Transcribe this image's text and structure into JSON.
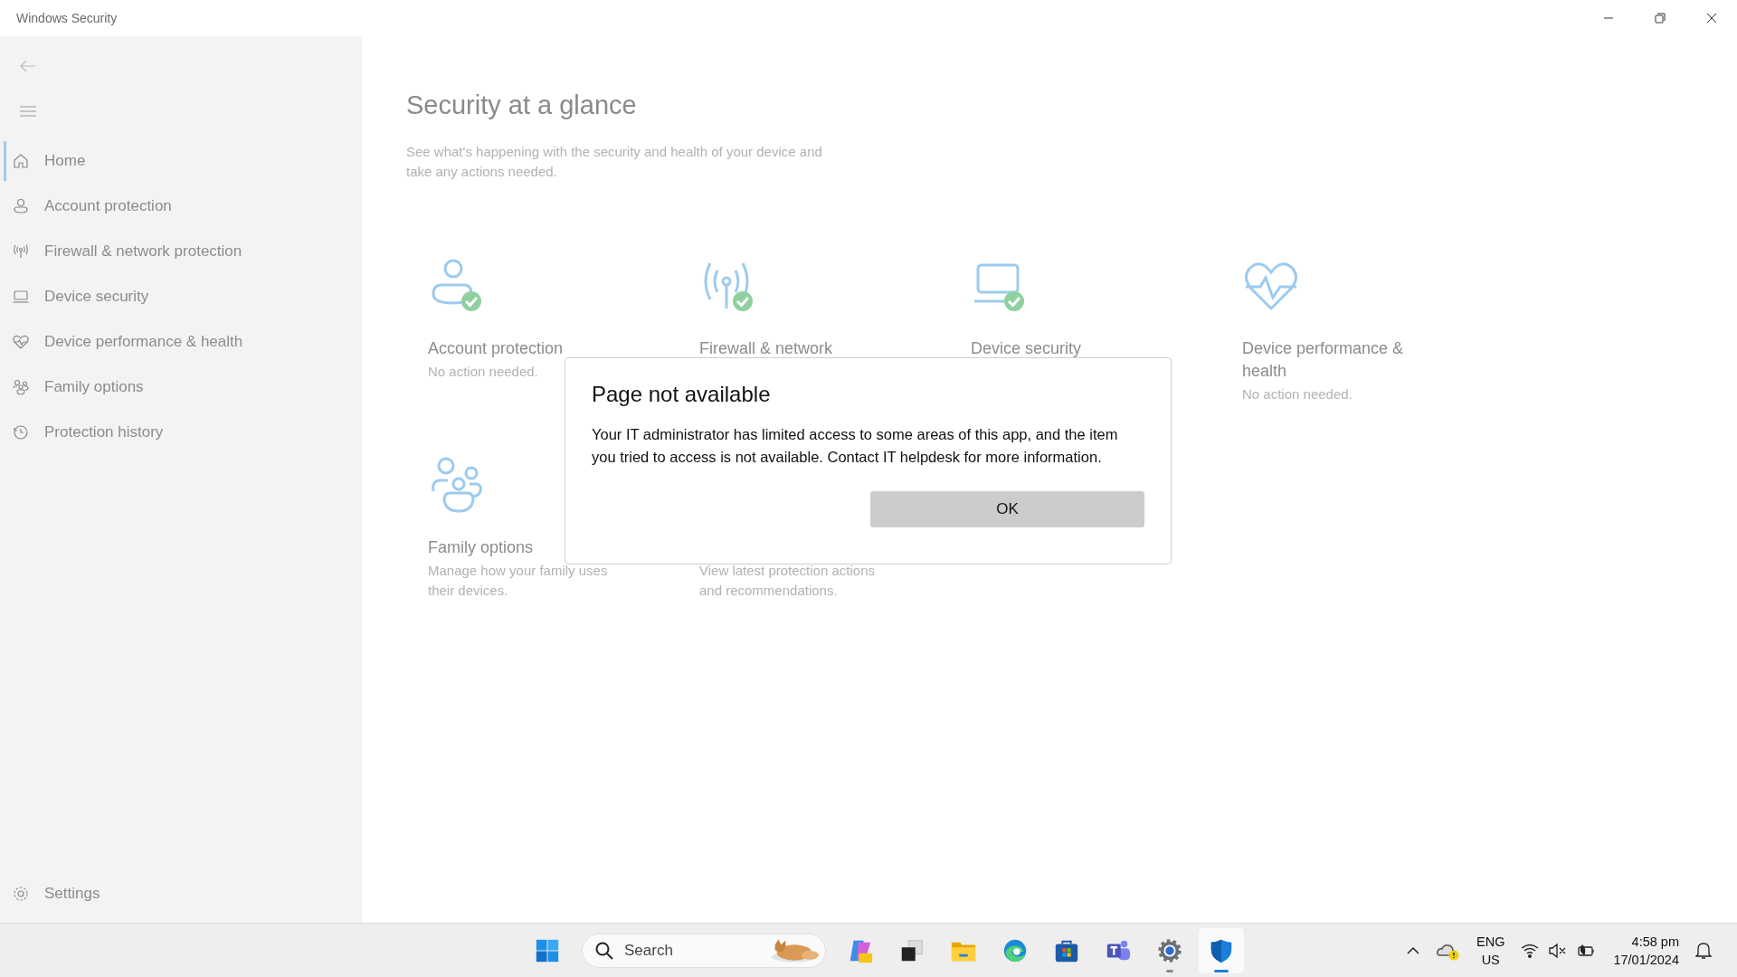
{
  "window": {
    "title": "Windows Security"
  },
  "sidebar": {
    "items": [
      {
        "label": "Home",
        "selected": true
      },
      {
        "label": "Account protection",
        "selected": false
      },
      {
        "label": "Firewall & network protection",
        "selected": false
      },
      {
        "label": "Device security",
        "selected": false
      },
      {
        "label": "Device performance & health",
        "selected": false
      },
      {
        "label": "Family options",
        "selected": false
      },
      {
        "label": "Protection history",
        "selected": false
      }
    ],
    "settings": "Settings"
  },
  "main": {
    "title": "Security at a glance",
    "subtitle": "See what's happening with the security and health of your device and take any actions needed.",
    "cards": [
      {
        "ok": true,
        "title": "Account protection",
        "description": "No action needed."
      },
      {
        "ok": true,
        "title": "Firewall & network"
      },
      {
        "ok": true,
        "title": "Device security"
      },
      {
        "ok": false,
        "title": "Device performance & health",
        "description": "No action needed."
      },
      {
        "ok": false,
        "title": "Family options",
        "description": "Manage how your family uses their devices."
      },
      {
        "description": "View latest protection actions and recommendations."
      }
    ]
  },
  "dialog": {
    "title": "Page not available",
    "message": "Your IT administrator has limited access to some areas of this app, and the item you tried to access is not available. Contact IT helpdesk for more information.",
    "button": "OK"
  },
  "taskbar": {
    "search": {
      "placeholder": "Search"
    },
    "apps": [
      {
        "kind": "copilot",
        "selected": false,
        "running": false
      },
      {
        "kind": "taskview",
        "selected": false,
        "running": false
      },
      {
        "kind": "explorer",
        "selected": false,
        "running": false
      },
      {
        "kind": "edge",
        "selected": false,
        "running": false
      },
      {
        "kind": "store",
        "selected": false,
        "running": false
      },
      {
        "kind": "teams",
        "selected": false,
        "running": false
      },
      {
        "kind": "settings",
        "selected": false,
        "running": true
      },
      {
        "kind": "security",
        "selected": true,
        "running": true
      }
    ],
    "language": "ENG",
    "region": "US",
    "time": "4:58 pm",
    "date": "17/01/2024"
  }
}
